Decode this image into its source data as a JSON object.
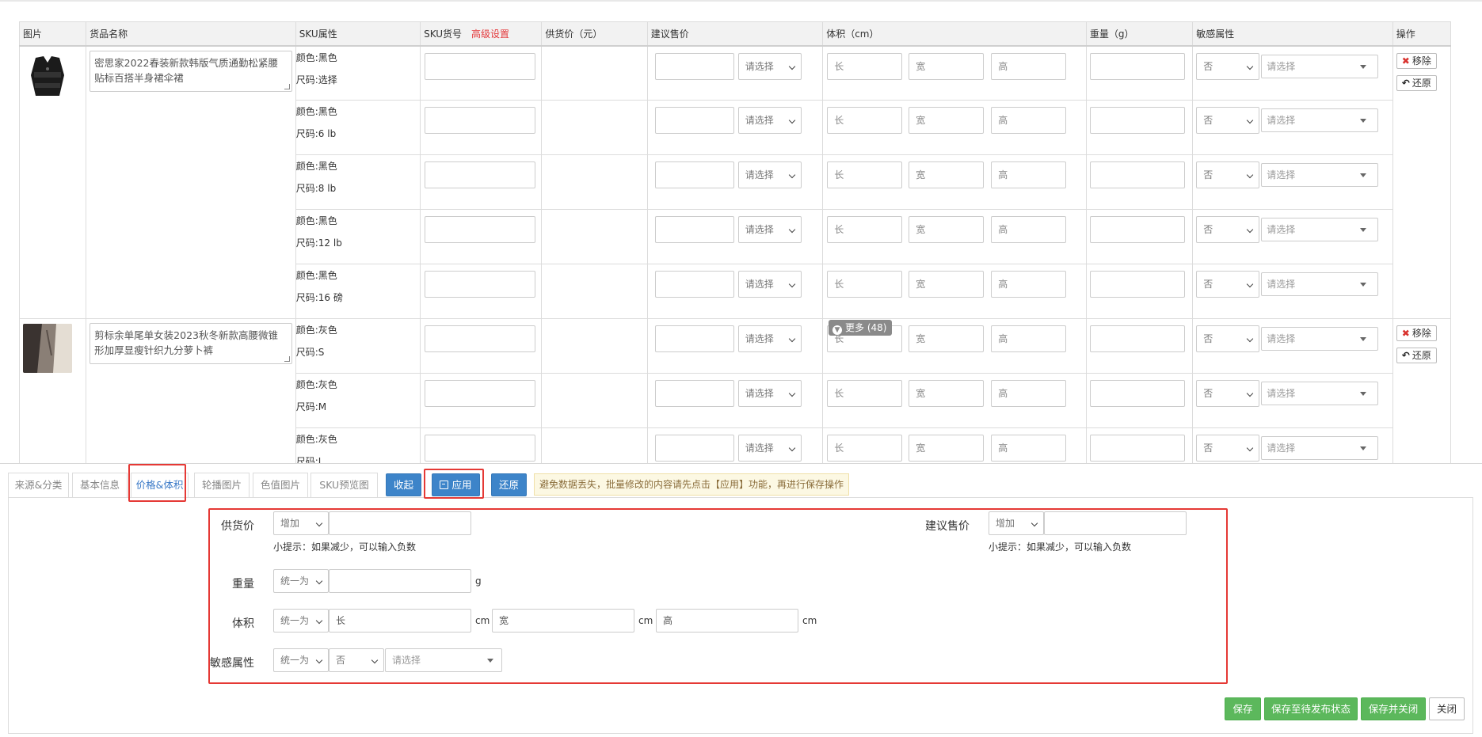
{
  "table": {
    "headers": {
      "image": "图片",
      "name": "货品名称",
      "sku_attr": "SKU属性",
      "sku_no": "SKU货号",
      "advanced": "高级设置",
      "supply_price": "供货价（元）",
      "suggest_price": "建议售价",
      "volume": "体积（cm）",
      "weight": "重量（g）",
      "sensitive": "敏感属性",
      "ops": "操作"
    },
    "placeholders": {
      "select": "请选择",
      "length": "长",
      "width": "宽",
      "height": "高",
      "no": "否"
    },
    "remove_label": "移除",
    "restore_label": "还原",
    "more_label": "更多 (48)",
    "products": [
      {
        "name": "密思家2022春装新款韩版气质通勤松紧腰贴标百搭半身裙伞裙",
        "skus": [
          {
            "color": "颜色:黑色",
            "size": "尺码:选择"
          },
          {
            "color": "颜色:黑色",
            "size": "尺码:6 lb"
          },
          {
            "color": "颜色:黑色",
            "size": "尺码:8 lb"
          },
          {
            "color": "颜色:黑色",
            "size": "尺码:12 lb"
          },
          {
            "color": "颜色:黑色",
            "size": "尺码:16 磅"
          }
        ]
      },
      {
        "name": "剪标余单尾单女装2023秋冬新款高腰微锥形加厚显瘦针织九分萝卜裤",
        "skus": [
          {
            "color": "颜色:灰色",
            "size": "尺码:S"
          },
          {
            "color": "颜色:灰色",
            "size": "尺码:M"
          },
          {
            "color": "颜色:灰色",
            "size": "尺码:L"
          }
        ]
      }
    ]
  },
  "tabs": [
    "来源&分类",
    "基本信息",
    "价格&体积",
    "轮播图片",
    "色值图片",
    "SKU预览图"
  ],
  "toolbar": {
    "collapse": "收起",
    "apply": "应用",
    "restore": "还原",
    "notice": "避免数据丢失，批量修改的内容请先点击【应用】功能，再进行保存操作"
  },
  "form": {
    "supply_label": "供货价",
    "supply_mode": "增加",
    "supply_hint": "小提示：如果减少，可以输入负数",
    "suggest_label": "建议售价",
    "suggest_mode": "增加",
    "suggest_hint": "小提示：如果减少，可以输入负数",
    "weight_label": "重量",
    "weight_mode": "统一为",
    "weight_unit": "g",
    "volume_label": "体积",
    "volume_mode": "统一为",
    "length_ph": "长",
    "width_ph": "宽",
    "height_ph": "高",
    "cm": "cm",
    "sensitive_label": "敏感属性",
    "sensitive_mode": "统一为",
    "sensitive_value": "否",
    "sensitive_select": "请选择"
  },
  "footer": {
    "save": "保存",
    "save_pending": "保存至待发布状态",
    "save_close": "保存并关闭",
    "close": "关闭"
  },
  "colors": {
    "primary": "#3d84c9",
    "success": "#5cb85c",
    "danger": "#e53935",
    "warning_bg": "#fcf8e3"
  }
}
